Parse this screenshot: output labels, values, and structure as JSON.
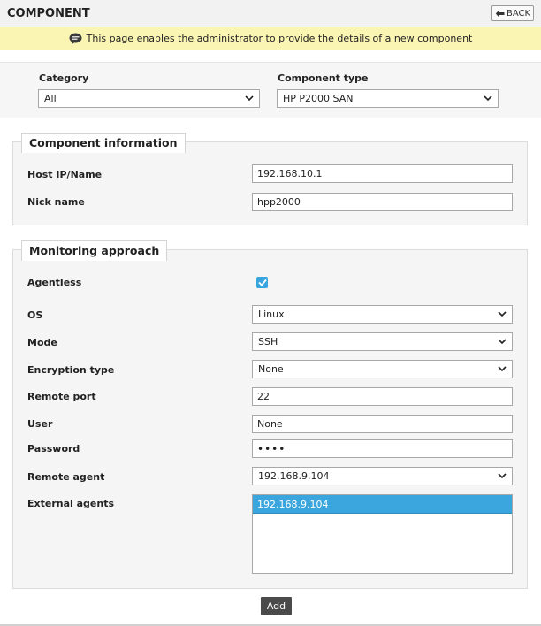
{
  "header": {
    "title": "COMPONENT",
    "back_label": "BACK"
  },
  "info_bar": {
    "message": "This page enables the administrator to provide the details of a new component"
  },
  "filters": {
    "category": {
      "label": "Category",
      "value": "All"
    },
    "component_type": {
      "label": "Component type",
      "value": "HP P2000 SAN"
    }
  },
  "component_info": {
    "title": "Component information",
    "host_ip": {
      "label": "Host IP/Name",
      "value": "192.168.10.1"
    },
    "nick_name": {
      "label": "Nick name",
      "value": "hpp2000"
    }
  },
  "monitoring": {
    "title": "Monitoring approach",
    "agentless": {
      "label": "Agentless",
      "checked": true
    },
    "os": {
      "label": "OS",
      "value": "Linux"
    },
    "mode": {
      "label": "Mode",
      "value": "SSH"
    },
    "encryption": {
      "label": "Encryption type",
      "value": "None"
    },
    "remote_port": {
      "label": "Remote port",
      "value": "22"
    },
    "user": {
      "label": "User",
      "value": "None"
    },
    "password": {
      "label": "Password",
      "value": "••••"
    },
    "remote_agent": {
      "label": "Remote agent",
      "value": "192.168.9.104"
    },
    "external_agents": {
      "label": "External agents",
      "items": [
        "192.168.9.104"
      ]
    }
  },
  "actions": {
    "add_label": "Add"
  },
  "colors": {
    "accent": "#3aa6dd",
    "info_bg": "#fbf5b4",
    "button_dark": "#4a4a4a"
  }
}
